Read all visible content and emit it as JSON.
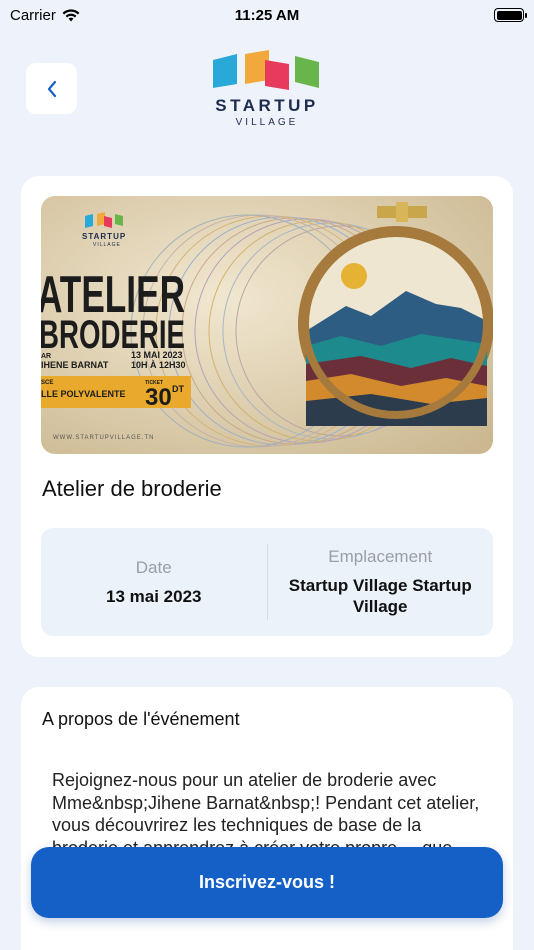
{
  "status_bar": {
    "carrier": "Carrier",
    "time": "11:25 AM"
  },
  "header": {
    "logo_word": "STARTUP",
    "logo_sub": "VILLAGE"
  },
  "banner": {
    "logo_word": "STARTUP",
    "logo_sub": "VILLAGE",
    "line1": "ATELIER",
    "line2": "BRODERIE",
    "host_prefix": "AR",
    "host_name": "IHENE BARNAT",
    "date": "13 MAI 2023",
    "hours": "10H À 12H30",
    "place_prefix": "SCE",
    "place": "LLE POLYVALENTE",
    "ticket_label": "TICKET",
    "price": "30",
    "currency": "DT",
    "website": "WWW.STARTUPVILLAGE.TN"
  },
  "event": {
    "title": "Atelier de broderie",
    "date_label": "Date",
    "date_value": "13 mai 2023",
    "location_label": "Emplacement",
    "location_value": "Startup Village Startup Village"
  },
  "about": {
    "title": "A propos de l'événement",
    "text": "Rejoignez-nous pour un atelier de broderie avec Mme&nbsp;Jihene Barnat&nbsp;! Pendant cet atelier, vous découvrirez les techniques de base de la broderie et apprendrez à créer votre propre ... que vous soyez débutant(e), ... ou que vous ayez déjà de l'expérience en"
  },
  "cta": {
    "label": "Inscrivez-vous !"
  },
  "colors": {
    "accent": "#1460c6",
    "background": "#eef3fb"
  }
}
